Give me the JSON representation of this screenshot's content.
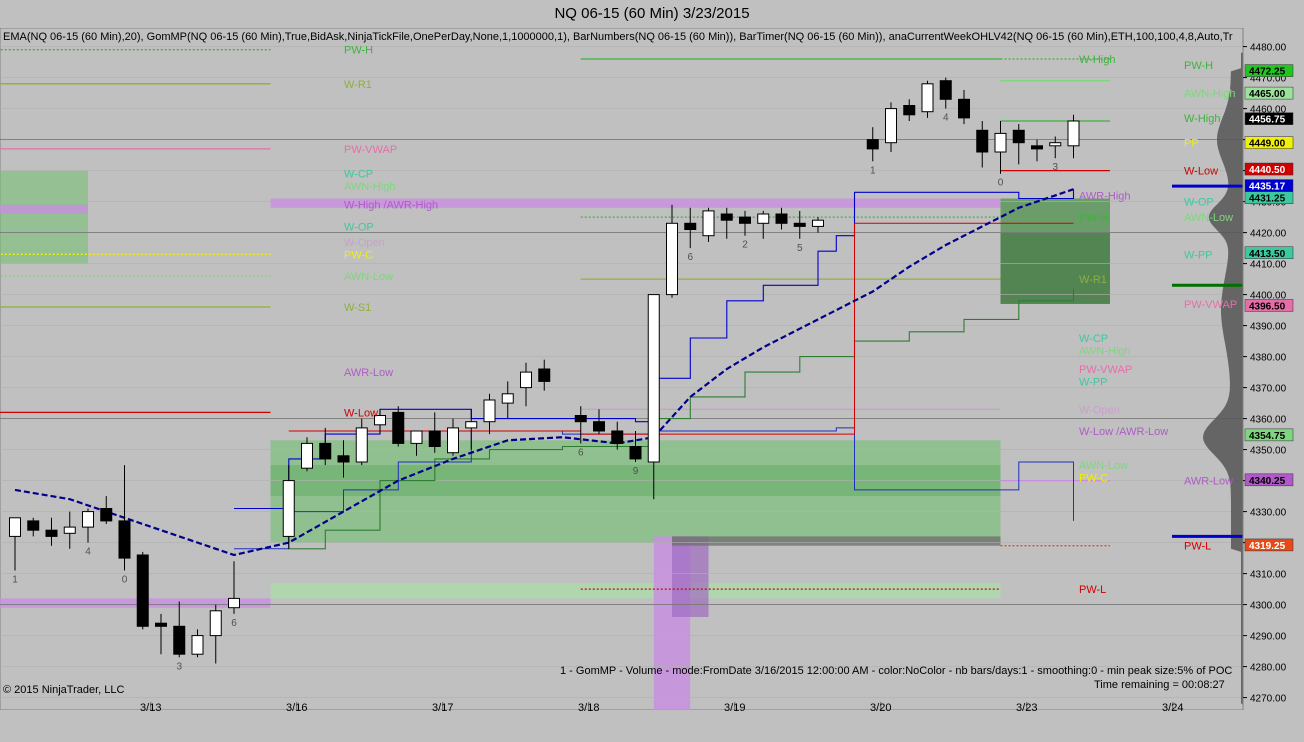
{
  "window": {
    "title": "NQ 06-15 (60 Min)  3/23/2015"
  },
  "indicators_text": "EMA(NQ 06-15 (60 Min),20), GomMP(NQ 06-15 (60 Min),True,BidAsk,NinjaTickFile,OnePerDay,None,1,1000000,1), BarNumbers(NQ 06-15 (60 Min)), BarTimer(NQ 06-15 (60 Min)), anaCurrentWeekOHLV42(NQ 06-15 (60 Min),ETH,100,100,4,8,Auto,Tr",
  "gom_label": "1 - GomMP - Volume - mode:FromDate 3/16/2015 12:00:00 AM  - color:NoColor - nb bars/days:1 - smoothing:0 - min peak size:5% of POC",
  "time_remaining": "Time remaining = 00:08:27",
  "copyright": "© 2015 NinjaTrader, LLC",
  "colors": {
    "background": "#c0c0c0",
    "up_candle": "#ffffff",
    "down_candle": "#000000",
    "ema": "#00008b",
    "channel_upper": "#0000cd",
    "channel_lower": "#2e7d32",
    "value_area": "#6fbf6f",
    "awr_band": "#c88fe0",
    "red_line": "#d00000"
  },
  "chart_data": {
    "type": "candlestick",
    "instrument": "NQ 06-15 (60 Min)",
    "ylim": [
      4266,
      4486
    ],
    "y_ticks": [
      4270,
      4280,
      4290,
      4300,
      4310,
      4320,
      4330,
      4340,
      4350,
      4360,
      4370,
      4380,
      4390,
      4400,
      4410,
      4420,
      4430,
      4440,
      4450,
      4460,
      4470,
      4480
    ],
    "x_ticks": [
      {
        "label": "3/13",
        "bar": 7
      },
      {
        "label": "3/16",
        "bar": 15
      },
      {
        "label": "3/17",
        "bar": 23
      },
      {
        "label": "3/18",
        "bar": 31
      },
      {
        "label": "3/19",
        "bar": 39
      },
      {
        "label": "3/20",
        "bar": 47
      },
      {
        "label": "3/23",
        "bar": 55
      },
      {
        "label": "3/24",
        "bar": 63
      }
    ],
    "candles": [
      {
        "bar": 0,
        "o": 4322,
        "h": 4328,
        "l": 4311,
        "c": 4328
      },
      {
        "bar": 1,
        "o": 4327,
        "h": 4328,
        "l": 4322,
        "c": 4324
      },
      {
        "bar": 2,
        "o": 4324,
        "h": 4328,
        "l": 4319,
        "c": 4322
      },
      {
        "bar": 3,
        "o": 4323,
        "h": 4330,
        "l": 4318,
        "c": 4325
      },
      {
        "bar": 4,
        "o": 4325,
        "h": 4331,
        "l": 4320,
        "c": 4330
      },
      {
        "bar": 5,
        "o": 4331,
        "h": 4335,
        "l": 4326,
        "c": 4327
      },
      {
        "bar": 6,
        "o": 4327,
        "h": 4345,
        "l": 4311,
        "c": 4315
      },
      {
        "bar": 7,
        "o": 4316,
        "h": 4317,
        "l": 4292,
        "c": 4293
      },
      {
        "bar": 8,
        "o": 4294,
        "h": 4297,
        "l": 4284,
        "c": 4293
      },
      {
        "bar": 9,
        "o": 4293,
        "h": 4301,
        "l": 4283,
        "c": 4284
      },
      {
        "bar": 10,
        "o": 4284,
        "h": 4292,
        "l": 4283,
        "c": 4290
      },
      {
        "bar": 11,
        "o": 4290,
        "h": 4300,
        "l": 4281,
        "c": 4298
      },
      {
        "bar": 12,
        "o": 4299,
        "h": 4314,
        "l": 4297,
        "c": 4302
      },
      {
        "bar": 15,
        "o": 4322,
        "h": 4345,
        "l": 4318,
        "c": 4340
      },
      {
        "bar": 16,
        "o": 4344,
        "h": 4354,
        "l": 4343,
        "c": 4352
      },
      {
        "bar": 17,
        "o": 4352,
        "h": 4357,
        "l": 4345,
        "c": 4347
      },
      {
        "bar": 18,
        "o": 4348,
        "h": 4353,
        "l": 4341,
        "c": 4346
      },
      {
        "bar": 19,
        "o": 4346,
        "h": 4360,
        "l": 4345,
        "c": 4357
      },
      {
        "bar": 20,
        "o": 4358,
        "h": 4363,
        "l": 4355,
        "c": 4361
      },
      {
        "bar": 21,
        "o": 4362,
        "h": 4364,
        "l": 4351,
        "c": 4352
      },
      {
        "bar": 22,
        "o": 4352,
        "h": 4356,
        "l": 4348,
        "c": 4356
      },
      {
        "bar": 23,
        "o": 4356,
        "h": 4362,
        "l": 4349,
        "c": 4351
      },
      {
        "bar": 24,
        "o": 4349,
        "h": 4360,
        "l": 4348,
        "c": 4357
      },
      {
        "bar": 25,
        "o": 4357,
        "h": 4363,
        "l": 4350,
        "c": 4359
      },
      {
        "bar": 26,
        "o": 4359,
        "h": 4368,
        "l": 4355,
        "c": 4366
      },
      {
        "bar": 27,
        "o": 4365,
        "h": 4372,
        "l": 4360,
        "c": 4368
      },
      {
        "bar": 28,
        "o": 4370,
        "h": 4378,
        "l": 4364,
        "c": 4375
      },
      {
        "bar": 29,
        "o": 4376,
        "h": 4379,
        "l": 4369,
        "c": 4372
      },
      {
        "bar": 31,
        "o": 4361,
        "h": 4364,
        "l": 4352,
        "c": 4359
      },
      {
        "bar": 32,
        "o": 4359,
        "h": 4363,
        "l": 4355,
        "c": 4356
      },
      {
        "bar": 33,
        "o": 4356,
        "h": 4359,
        "l": 4350,
        "c": 4352
      },
      {
        "bar": 34,
        "o": 4351,
        "h": 4356,
        "l": 4346,
        "c": 4347
      },
      {
        "bar": 35,
        "o": 4346,
        "h": 4360,
        "l": 4334,
        "c": 4400
      },
      {
        "bar": 36,
        "o": 4400,
        "h": 4429,
        "l": 4399,
        "c": 4423
      },
      {
        "bar": 37,
        "o": 4423,
        "h": 4428,
        "l": 4415,
        "c": 4421
      },
      {
        "bar": 38,
        "o": 4419,
        "h": 4428,
        "l": 4417,
        "c": 4427
      },
      {
        "bar": 39,
        "o": 4426,
        "h": 4428,
        "l": 4418,
        "c": 4424
      },
      {
        "bar": 40,
        "o": 4425,
        "h": 4427,
        "l": 4419,
        "c": 4423
      },
      {
        "bar": 41,
        "o": 4423,
        "h": 4427,
        "l": 4418,
        "c": 4426
      },
      {
        "bar": 42,
        "o": 4426,
        "h": 4428,
        "l": 4421,
        "c": 4423
      },
      {
        "bar": 43,
        "o": 4423,
        "h": 4427,
        "l": 4418,
        "c": 4422
      },
      {
        "bar": 44,
        "o": 4422,
        "h": 4425,
        "l": 4420,
        "c": 4424
      },
      {
        "bar": 47,
        "o": 4450,
        "h": 4454,
        "l": 4443,
        "c": 4447
      },
      {
        "bar": 48,
        "o": 4449,
        "h": 4462,
        "l": 4446,
        "c": 4460
      },
      {
        "bar": 49,
        "o": 4461,
        "h": 4463,
        "l": 4456,
        "c": 4458
      },
      {
        "bar": 50,
        "o": 4459,
        "h": 4469,
        "l": 4457,
        "c": 4468
      },
      {
        "bar": 51,
        "o": 4469,
        "h": 4470,
        "l": 4460,
        "c": 4463
      },
      {
        "bar": 52,
        "o": 4463,
        "h": 4466,
        "l": 4455,
        "c": 4457
      },
      {
        "bar": 53,
        "o": 4453,
        "h": 4456,
        "l": 4441,
        "c": 4446
      },
      {
        "bar": 54,
        "o": 4446,
        "h": 4456,
        "l": 4439,
        "c": 4452
      },
      {
        "bar": 55,
        "o": 4453,
        "h": 4455,
        "l": 4442,
        "c": 4449
      },
      {
        "bar": 56,
        "o": 4448,
        "h": 4450,
        "l": 4443,
        "c": 4447
      },
      {
        "bar": 57,
        "o": 4448,
        "h": 4451,
        "l": 4444,
        "c": 4449
      },
      {
        "bar": 58,
        "o": 4448,
        "h": 4458,
        "l": 4444,
        "c": 4456
      }
    ],
    "bar_numbers": [
      {
        "bar": 0,
        "text": "1"
      },
      {
        "bar": 4,
        "text": "4"
      },
      {
        "bar": 6,
        "text": "0"
      },
      {
        "bar": 9,
        "text": "3"
      },
      {
        "bar": 12,
        "text": "6"
      },
      {
        "bar": 31,
        "text": "6"
      },
      {
        "bar": 34,
        "text": "9"
      },
      {
        "bar": 37,
        "text": "6"
      },
      {
        "bar": 40,
        "text": "2"
      },
      {
        "bar": 43,
        "text": "5"
      },
      {
        "bar": 47,
        "text": "1"
      },
      {
        "bar": 51,
        "text": "4"
      },
      {
        "bar": 54,
        "text": "0"
      },
      {
        "bar": 57,
        "text": "3"
      }
    ],
    "ema20": [
      [
        0,
        4337
      ],
      [
        3,
        4334
      ],
      [
        6,
        4328
      ],
      [
        9,
        4322
      ],
      [
        12,
        4316
      ],
      [
        15,
        4320
      ],
      [
        18,
        4330
      ],
      [
        21,
        4340
      ],
      [
        24,
        4347
      ],
      [
        27,
        4353
      ],
      [
        30,
        4354
      ],
      [
        33,
        4352
      ],
      [
        35,
        4354
      ],
      [
        37,
        4367
      ],
      [
        39,
        4376
      ],
      [
        41,
        4383
      ],
      [
        43,
        4389
      ],
      [
        45,
        4395
      ],
      [
        47,
        4401
      ],
      [
        49,
        4409
      ],
      [
        51,
        4416
      ],
      [
        53,
        4422
      ],
      [
        55,
        4428
      ],
      [
        57,
        4432
      ],
      [
        58,
        4434
      ]
    ],
    "channel_upper": [
      [
        12,
        4331
      ],
      [
        15,
        4347
      ],
      [
        17,
        4355
      ],
      [
        20,
        4363
      ],
      [
        23,
        4363
      ],
      [
        25,
        4360
      ],
      [
        30,
        4360
      ],
      [
        34,
        4359
      ],
      [
        35,
        4373
      ],
      [
        37,
        4386
      ],
      [
        39,
        4398
      ],
      [
        41,
        4403
      ],
      [
        44,
        4414
      ],
      [
        45,
        4419
      ],
      [
        46,
        4433
      ],
      [
        51,
        4433
      ],
      [
        55,
        4431
      ],
      [
        58,
        4434
      ]
    ],
    "channel_lower": [
      [
        15,
        4318
      ],
      [
        17,
        4324
      ],
      [
        20,
        4340
      ],
      [
        23,
        4347
      ],
      [
        26,
        4350
      ],
      [
        30,
        4351
      ],
      [
        35,
        4360
      ],
      [
        37,
        4367
      ],
      [
        40,
        4375
      ],
      [
        43,
        4380
      ],
      [
        46,
        4385
      ],
      [
        49,
        4388
      ],
      [
        52,
        4392
      ],
      [
        55,
        4398
      ],
      [
        58,
        4402
      ]
    ],
    "channel_mid": [
      [
        12,
        4318
      ],
      [
        15,
        4330
      ],
      [
        18,
        4337
      ],
      [
        21,
        4346
      ],
      [
        25,
        4356
      ],
      [
        30,
        4355
      ],
      [
        35,
        4356
      ],
      [
        45,
        4357
      ],
      [
        46,
        4337
      ],
      [
        52,
        4337
      ],
      [
        55,
        4346
      ],
      [
        58,
        4327
      ]
    ],
    "level_labels": [
      {
        "text": "PW-H",
        "y": 4479,
        "pos": "left",
        "color": "#3cb43c"
      },
      {
        "text": "W-R1",
        "y": 4468,
        "pos": "left",
        "color": "#8faf3c"
      },
      {
        "text": "PW-VWAP",
        "y": 4447,
        "pos": "left",
        "color": "#e46fa8"
      },
      {
        "text": "W-CP",
        "y": 4439,
        "pos": "left",
        "color": "#3cc8a0"
      },
      {
        "text": "AWN-High",
        "y": 4435,
        "pos": "left",
        "color": "#7ed67e"
      },
      {
        "text": "W-High /AWR-High",
        "y": 4429,
        "pos": "left",
        "color": "#b05ac8"
      },
      {
        "text": "W-OP",
        "y": 4422,
        "pos": "left",
        "color": "#3cc8a0"
      },
      {
        "text": "W-Open",
        "y": 4417,
        "pos": "left",
        "color": "#c8a0c8"
      },
      {
        "text": "PW-C",
        "y": 4413,
        "pos": "left",
        "color": "#f0f000"
      },
      {
        "text": "AWN-Low",
        "y": 4406,
        "pos": "left",
        "color": "#7ed67e"
      },
      {
        "text": "W-S1",
        "y": 4396,
        "pos": "left",
        "color": "#8faf3c"
      },
      {
        "text": "AWR-Low",
        "y": 4375,
        "pos": "left",
        "color": "#b05ac8"
      },
      {
        "text": "W-Low",
        "y": 4362,
        "pos": "left",
        "color": "#d00000"
      },
      {
        "text": "W-High",
        "y": 4476,
        "pos": "mid",
        "color": "#3cb43c"
      },
      {
        "text": "AWR-High",
        "y": 4432,
        "pos": "mid",
        "color": "#b05ac8"
      },
      {
        "text": "PW-H",
        "y": 4425,
        "pos": "mid",
        "color": "#3cb43c"
      },
      {
        "text": "W-R1",
        "y": 4405,
        "pos": "mid",
        "color": "#8faf3c"
      },
      {
        "text": "W-CP",
        "y": 4386,
        "pos": "mid",
        "color": "#3cc8a0"
      },
      {
        "text": "AWN-High",
        "y": 4382,
        "pos": "mid",
        "color": "#7ed67e"
      },
      {
        "text": "PW-VWAP",
        "y": 4376,
        "pos": "mid",
        "color": "#e46fa8"
      },
      {
        "text": "W-PP",
        "y": 4372,
        "pos": "mid",
        "color": "#3cc8a0"
      },
      {
        "text": "W-Open",
        "y": 4363,
        "pos": "mid",
        "color": "#c8a0c8"
      },
      {
        "text": "W-Low /AWR-Low",
        "y": 4356,
        "pos": "mid",
        "color": "#b05ac8"
      },
      {
        "text": "AWN-Low",
        "y": 4345,
        "pos": "mid",
        "color": "#7ed67e"
      },
      {
        "text": "PW-C",
        "y": 4341,
        "pos": "mid",
        "color": "#f0f000"
      },
      {
        "text": "PW-L",
        "y": 4305,
        "pos": "mid",
        "color": "#d00000"
      },
      {
        "text": "PW-H",
        "y": 4474,
        "pos": "right",
        "color": "#3cb43c"
      },
      {
        "text": "AWN-High",
        "y": 4465,
        "pos": "right",
        "color": "#7ed67e"
      },
      {
        "text": "W-High",
        "y": 4457,
        "pos": "right",
        "color": "#3cb43c"
      },
      {
        "text": "PP",
        "y": 4449,
        "pos": "right",
        "color": "#f0f000"
      },
      {
        "text": "W-Low",
        "y": 4440,
        "pos": "right",
        "color": "#d00000"
      },
      {
        "text": "W-OP",
        "y": 4430,
        "pos": "right",
        "color": "#3cc8a0"
      },
      {
        "text": "AWN-Low",
        "y": 4425,
        "pos": "right",
        "color": "#7ed67e"
      },
      {
        "text": "W-PP",
        "y": 4413,
        "pos": "right",
        "color": "#3cc8a0"
      },
      {
        "text": "PW-VWAP",
        "y": 4397,
        "pos": "right",
        "color": "#e46fa8"
      },
      {
        "text": "AWR-Low",
        "y": 4340,
        "pos": "right",
        "color": "#b05ac8"
      },
      {
        "text": "PW-L",
        "y": 4319,
        "pos": "right",
        "color": "#d00000"
      }
    ],
    "price_badges": [
      {
        "value": "4480.00",
        "y": 4480,
        "style": "tick"
      },
      {
        "value": "4472.25",
        "y": 4472.25,
        "bg": "#22c422",
        "fg": "#000"
      },
      {
        "value": "4465.00",
        "y": 4465,
        "bg": "#9be29b",
        "fg": "#000"
      },
      {
        "value": "4456.75",
        "y": 4456.75,
        "bg": "#000000",
        "fg": "#fff"
      },
      {
        "value": "4449.00",
        "y": 4449,
        "bg": "#f0f000",
        "fg": "#000"
      },
      {
        "value": "4440.50",
        "y": 4440.5,
        "bg": "#d00000",
        "fg": "#fff"
      },
      {
        "value": "4435.17",
        "y": 4435.17,
        "bg": "#0000cd",
        "fg": "#fff"
      },
      {
        "value": "4431.25",
        "y": 4431.25,
        "bg": "#3cc8a0",
        "fg": "#000"
      },
      {
        "value": "4413.50",
        "y": 4413.5,
        "bg": "#3cc8a0",
        "fg": "#000"
      },
      {
        "value": "4396.50",
        "y": 4396.5,
        "bg": "#e46fa8",
        "fg": "#000"
      },
      {
        "value": "4354.75",
        "y": 4354.75,
        "bg": "#7ed67e",
        "fg": "#000"
      },
      {
        "value": "4340.25",
        "y": 4340.25,
        "bg": "#b05ac8",
        "fg": "#000"
      },
      {
        "value": "4319.25",
        "y": 4319.25,
        "bg": "#e64a19",
        "fg": "#fff"
      }
    ]
  }
}
